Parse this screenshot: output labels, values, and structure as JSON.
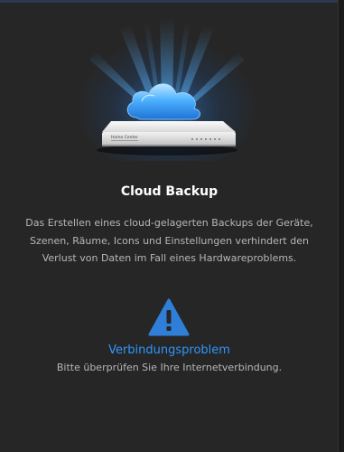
{
  "device_label": "Home Center",
  "title": "Cloud Backup",
  "description": "Das Erstellen eines cloud-gelagerten Backups der Geräte, Szenen, Räume, Icons und Einstellungen verhindert den Verlust von Daten im Fall eines Hardwareproblems.",
  "status": {
    "icon": "warning-triangle-icon",
    "heading": "Verbindungsproblem",
    "message": "Bitte überprüfen Sie Ihre Internetverbindung."
  },
  "colors": {
    "accent": "#2f96ff",
    "panel": "#262626",
    "text_muted": "#b7b7b7"
  }
}
